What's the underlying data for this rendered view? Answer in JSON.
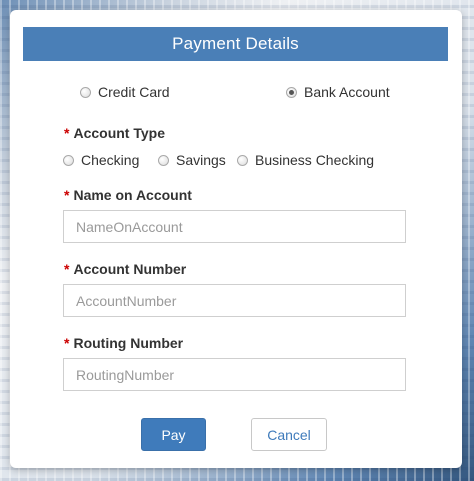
{
  "dialog": {
    "title": "Payment Details",
    "payment_methods": [
      {
        "label": "Credit Card",
        "selected": false
      },
      {
        "label": "Bank Account",
        "selected": true
      }
    ],
    "account_type": {
      "required_mark": "*",
      "label": "Account Type",
      "options": [
        {
          "label": "Checking",
          "selected": false
        },
        {
          "label": "Savings",
          "selected": false
        },
        {
          "label": "Business Checking",
          "selected": false
        }
      ]
    },
    "name_on_account": {
      "required_mark": "*",
      "label": "Name on Account",
      "placeholder": "NameOnAccount",
      "value": ""
    },
    "account_number": {
      "required_mark": "*",
      "label": "Account Number",
      "placeholder": "AccountNumber",
      "value": ""
    },
    "routing_number": {
      "required_mark": "*",
      "label": "Routing Number",
      "placeholder": "RoutingNumber",
      "value": ""
    },
    "buttons": {
      "pay": "Pay",
      "cancel": "Cancel"
    }
  },
  "colors": {
    "header_bg": "#4a7fb7",
    "required": "#cc0000",
    "primary_button": "#3f7bbb"
  }
}
